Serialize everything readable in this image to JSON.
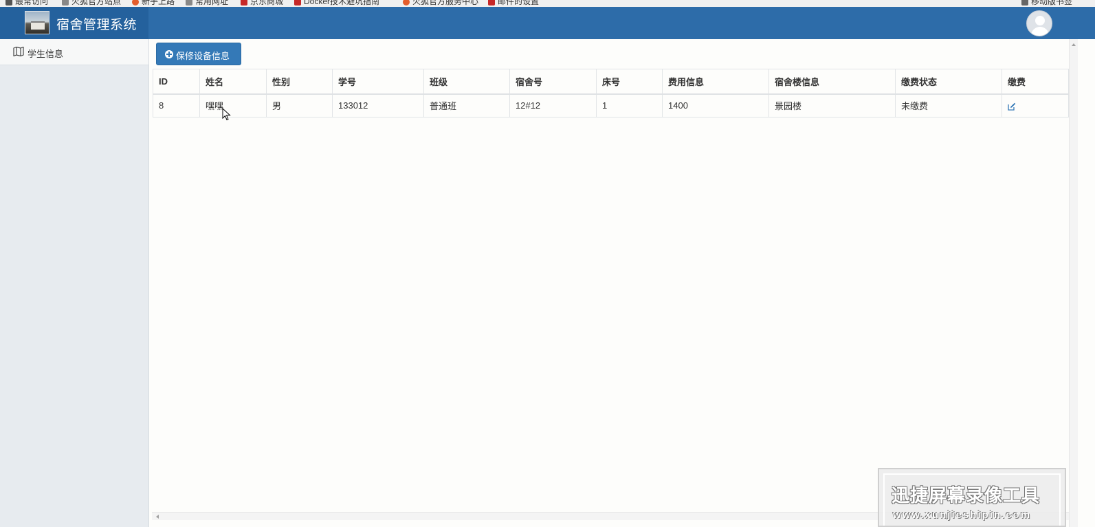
{
  "bookmarks": [
    {
      "label": "最常访问",
      "color": "#555555",
      "icon": "gear-icon"
    },
    {
      "label": "火狐官方站点",
      "color": "#888888",
      "icon": "folder-icon"
    },
    {
      "label": "新手上路",
      "color": "#e35d2c",
      "icon": "firefox-icon"
    },
    {
      "label": "常用网址",
      "color": "#888888",
      "icon": "folder-icon"
    },
    {
      "label": "京东商城",
      "color": "#c62828",
      "icon": "jd-icon"
    },
    {
      "label": "Docker技术避坑指南",
      "color": "#c62828",
      "icon": "csdn-icon"
    },
    {
      "label": "火狐官方服务中心",
      "color": "#e35d2c",
      "icon": "firefox-icon"
    },
    {
      "label": "邮件的设置",
      "color": "#c62828",
      "icon": "csdn-icon"
    },
    {
      "label": "移动版书签",
      "color": "#666666",
      "icon": "mobile-icon"
    }
  ],
  "header": {
    "app_title": "宿舍管理系统",
    "brand_color": "#24619d",
    "bar_color": "#2d6ca9"
  },
  "sidebar": {
    "items": [
      {
        "label": "学生信息",
        "icon": "map-icon"
      }
    ]
  },
  "toolbar": {
    "add_label": "保修设备信息",
    "add_icon": "plus-circle-icon",
    "button_color": "#3479b7"
  },
  "table": {
    "columns": [
      "ID",
      "姓名",
      "性别",
      "学号",
      "班级",
      "宿舍号",
      "床号",
      "费用信息",
      "宿舍楼信息",
      "缴费状态",
      "缴费"
    ],
    "rows": [
      {
        "id": "8",
        "name": "嘿嘿",
        "gender": "男",
        "student_no": "133012",
        "class": "普通班",
        "dorm_no": "12#12",
        "bed_no": "1",
        "fee": "1400",
        "building": "景园楼",
        "pay_status": "未缴费",
        "action_icon": "edit-icon"
      }
    ]
  },
  "watermark": {
    "title": "迅捷屏幕录像工具",
    "url": "www.xunjieshipin.com"
  }
}
